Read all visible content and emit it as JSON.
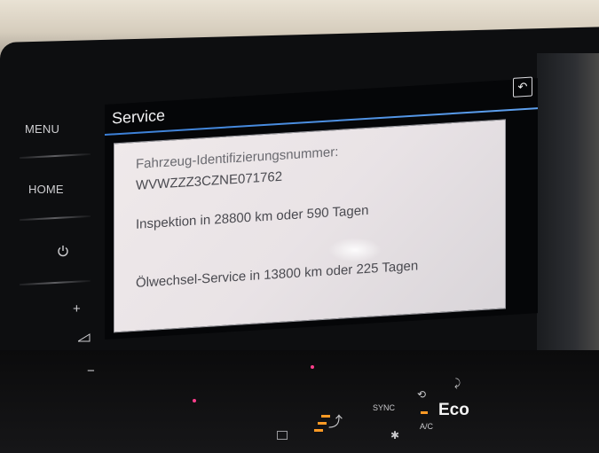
{
  "hard_keys": {
    "menu": "MENU",
    "home": "HOME",
    "power_icon": "power-icon",
    "volume_up": "+",
    "volume_icon": "volume-icon",
    "volume_down": "−"
  },
  "screen": {
    "title": "Service",
    "back_icon": "back-arrow-icon",
    "panel": {
      "vin_label": "Fahrzeug-Identifizierungsnummer:",
      "vin_value": "WVWZZZ3CZNE071762",
      "inspection": "Inspektion in 28800 km oder 590 Tagen",
      "oil_service": "Ölwechsel-Service in 13800 km oder 225 Tagen"
    }
  },
  "climate": {
    "sync": "SYNC",
    "ac": "A/C",
    "eco": "Eco"
  },
  "colors": {
    "title_underline": "#3b7fd6",
    "led_orange": "#ff9a25",
    "led_pink": "#ff3f8c"
  }
}
